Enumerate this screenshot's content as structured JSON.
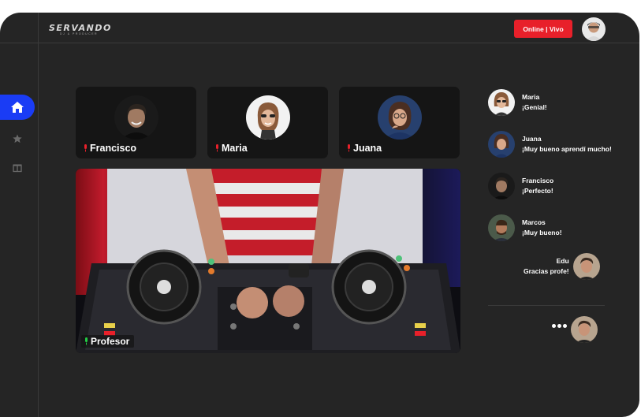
{
  "app": {
    "logo_text": "SERVANDO",
    "logo_sub": "DJ & PRODUCER",
    "live_label": "Online | Vivo"
  },
  "sidebar": {
    "items": [
      {
        "icon": "home-icon",
        "active": true
      },
      {
        "icon": "star-icon",
        "active": false
      },
      {
        "icon": "gift-icon",
        "active": false
      }
    ]
  },
  "participants": [
    {
      "name": "Francisco",
      "mic_color": "#e8202a"
    },
    {
      "name": "Maria",
      "mic_color": "#e8202a"
    },
    {
      "name": "Juana",
      "mic_color": "#e8202a"
    }
  ],
  "main_video": {
    "name": "Profesor",
    "mic_color": "#22cc44"
  },
  "chat": {
    "messages": [
      {
        "user": "Maria",
        "text": "¡Genial!"
      },
      {
        "user": "Juana",
        "text": "¡Muy bueno aprendí mucho!"
      },
      {
        "user": "Francisco",
        "text": "¡Perfecto!"
      },
      {
        "user": "Marcos",
        "text": "¡Muy bueno!"
      },
      {
        "user": "Edu",
        "text": "Gracias profe!"
      }
    ],
    "typing_indicator": "typing-dots-icon"
  },
  "colors": {
    "accent": "#1a3cf5",
    "live": "#e8202a",
    "background": "#252525",
    "tile": "#151515"
  }
}
